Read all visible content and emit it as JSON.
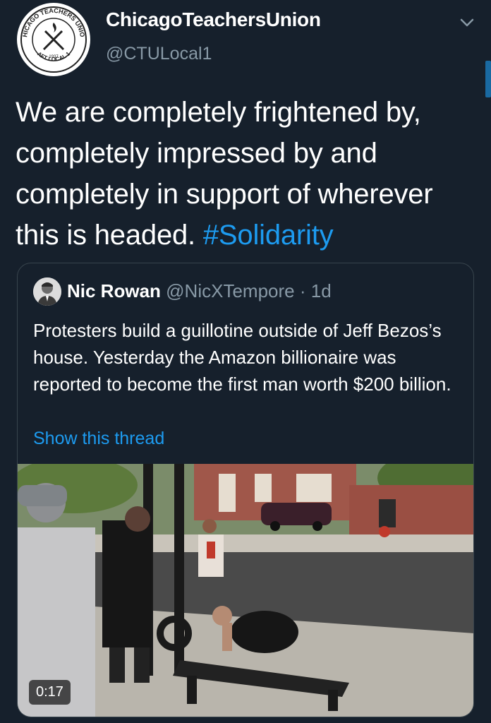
{
  "tweet": {
    "display_name": "ChicagoTeachersUnion",
    "handle": "@CTULocal1",
    "text_main": "We are completely frightened by, completely impressed by and completely in support of wherever this is headed. ",
    "hashtag": "#Solidarity",
    "avatar_icon": "union-seal-logo",
    "menu_icon": "chevron-down-icon"
  },
  "avatar_seal": {
    "ring_text": "CHICAGO TEACHERS UNION",
    "bottom_text": "AFT LOCAL 1",
    "inner_text_top": "ORGANIZE",
    "inner_text_year": "1937"
  },
  "quote": {
    "name": "Nic Rowan",
    "handle": "@NicXTempore",
    "separator": "·",
    "time": "1d",
    "text": "Protesters build a guillotine outside of Jeff Bezos’s house. Yesterday the Amazon billionaire was reported to become the first man worth $200 billion.",
    "show_thread": "Show this thread",
    "video_duration": "0:17"
  },
  "colors": {
    "background": "#16202c",
    "link": "#1d9bf0",
    "secondary_text": "#8899a6",
    "border": "#38444d"
  }
}
